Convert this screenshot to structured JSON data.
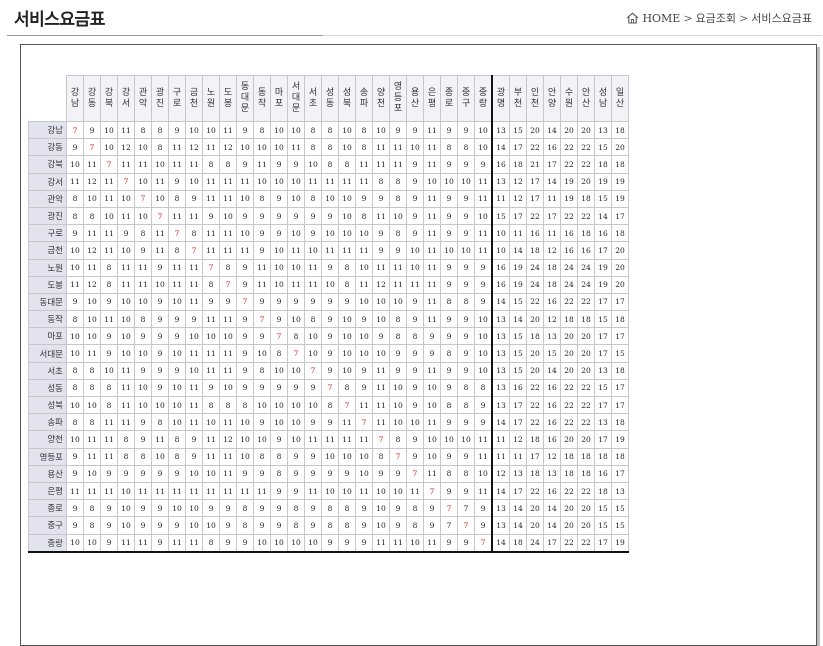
{
  "page": {
    "title": "서비스요금표",
    "breadcrumb": [
      "HOME",
      "요금조회",
      "서비스요금표"
    ],
    "breadcrumb_sep": ">"
  },
  "table": {
    "local_cols": [
      "강남",
      "강동",
      "강북",
      "강서",
      "관악",
      "광진",
      "구로",
      "금천",
      "노원",
      "도봉",
      "동대문",
      "동작",
      "마포",
      "서대문",
      "서초",
      "성동",
      "성북",
      "송파",
      "양천",
      "영등포",
      "용산",
      "은평",
      "종로",
      "중구",
      "중랑"
    ],
    "far_cols": [
      "광명",
      "부천",
      "인천",
      "안양",
      "수원",
      "안산",
      "성남",
      "일산"
    ],
    "rows": [
      {
        "name": "강남",
        "cells": [
          "7",
          "9",
          "10",
          "11",
          "8",
          "8",
          "9",
          "10",
          "10",
          "11",
          "9",
          "8",
          "10",
          "10",
          "8",
          "8",
          "10",
          "8",
          "10",
          "9",
          "9",
          "11",
          "9",
          "9",
          "10",
          "13",
          "15",
          "20",
          "14",
          "20",
          "20",
          "13",
          "18"
        ]
      },
      {
        "name": "강동",
        "cells": [
          "9",
          "7",
          "10",
          "12",
          "10",
          "8",
          "11",
          "12",
          "11",
          "12",
          "10",
          "10",
          "10",
          "11",
          "8",
          "8",
          "10",
          "8",
          "11",
          "11",
          "10",
          "11",
          "8",
          "8",
          "10",
          "14",
          "17",
          "22",
          "16",
          "22",
          "22",
          "15",
          "20"
        ]
      },
      {
        "name": "강북",
        "cells": [
          "10",
          "11",
          "7",
          "11",
          "11",
          "10",
          "11",
          "11",
          "8",
          "8",
          "9",
          "11",
          "9",
          "9",
          "10",
          "8",
          "8",
          "11",
          "11",
          "11",
          "9",
          "11",
          "9",
          "9",
          "9",
          "16",
          "18",
          "21",
          "17",
          "22",
          "22",
          "18",
          "18"
        ]
      },
      {
        "name": "강서",
        "cells": [
          "11",
          "12",
          "11",
          "7",
          "10",
          "11",
          "9",
          "10",
          "11",
          "11",
          "11",
          "10",
          "10",
          "10",
          "11",
          "11",
          "11",
          "11",
          "8",
          "8",
          "9",
          "10",
          "10",
          "10",
          "11",
          "13",
          "12",
          "17",
          "14",
          "19",
          "20",
          "19",
          "19"
        ]
      },
      {
        "name": "관악",
        "cells": [
          "8",
          "10",
          "11",
          "10",
          "7",
          "10",
          "8",
          "9",
          "11",
          "11",
          "10",
          "8",
          "9",
          "10",
          "8",
          "10",
          "10",
          "9",
          "9",
          "8",
          "9",
          "11",
          "9",
          "9",
          "11",
          "11",
          "12",
          "17",
          "11",
          "19",
          "18",
          "15",
          "19"
        ]
      },
      {
        "name": "광진",
        "cells": [
          "8",
          "8",
          "10",
          "11",
          "10",
          "7",
          "11",
          "11",
          "9",
          "10",
          "9",
          "9",
          "9",
          "9",
          "9",
          "9",
          "10",
          "8",
          "11",
          "10",
          "9",
          "11",
          "9",
          "9",
          "10",
          "15",
          "17",
          "22",
          "17",
          "22",
          "22",
          "14",
          "17"
        ]
      },
      {
        "name": "구로",
        "cells": [
          "9",
          "11",
          "11",
          "9",
          "8",
          "11",
          "7",
          "8",
          "11",
          "11",
          "10",
          "9",
          "9",
          "10",
          "9",
          "10",
          "10",
          "10",
          "9",
          "8",
          "9",
          "11",
          "9",
          "9",
          "11",
          "10",
          "11",
          "16",
          "11",
          "16",
          "18",
          "16",
          "18"
        ]
      },
      {
        "name": "금천",
        "cells": [
          "10",
          "12",
          "11",
          "10",
          "9",
          "11",
          "8",
          "7",
          "11",
          "11",
          "11",
          "9",
          "10",
          "11",
          "10",
          "11",
          "11",
          "11",
          "9",
          "9",
          "10",
          "11",
          "10",
          "10",
          "11",
          "10",
          "14",
          "18",
          "12",
          "16",
          "16",
          "17",
          "20"
        ]
      },
      {
        "name": "노원",
        "cells": [
          "10",
          "11",
          "8",
          "11",
          "11",
          "9",
          "11",
          "11",
          "7",
          "8",
          "9",
          "11",
          "10",
          "10",
          "11",
          "9",
          "8",
          "10",
          "11",
          "11",
          "10",
          "11",
          "9",
          "9",
          "9",
          "16",
          "19",
          "24",
          "18",
          "24",
          "24",
          "19",
          "20"
        ]
      },
      {
        "name": "도봉",
        "cells": [
          "11",
          "12",
          "8",
          "11",
          "11",
          "10",
          "11",
          "11",
          "8",
          "7",
          "9",
          "11",
          "10",
          "11",
          "11",
          "10",
          "8",
          "11",
          "12",
          "11",
          "11",
          "11",
          "9",
          "9",
          "9",
          "16",
          "19",
          "24",
          "18",
          "24",
          "24",
          "19",
          "20"
        ]
      },
      {
        "name": "동대문",
        "cells": [
          "9",
          "10",
          "9",
          "10",
          "10",
          "9",
          "10",
          "11",
          "9",
          "9",
          "7",
          "9",
          "9",
          "9",
          "9",
          "9",
          "9",
          "10",
          "10",
          "10",
          "9",
          "11",
          "8",
          "8",
          "9",
          "14",
          "15",
          "22",
          "16",
          "22",
          "22",
          "17",
          "17"
        ]
      },
      {
        "name": "동작",
        "cells": [
          "8",
          "10",
          "11",
          "10",
          "8",
          "9",
          "9",
          "9",
          "11",
          "11",
          "9",
          "7",
          "9",
          "10",
          "8",
          "9",
          "10",
          "9",
          "10",
          "8",
          "9",
          "11",
          "9",
          "9",
          "10",
          "13",
          "14",
          "20",
          "12",
          "18",
          "18",
          "15",
          "18"
        ]
      },
      {
        "name": "마포",
        "cells": [
          "10",
          "10",
          "9",
          "10",
          "9",
          "9",
          "9",
          "10",
          "10",
          "10",
          "9",
          "9",
          "7",
          "8",
          "10",
          "9",
          "10",
          "10",
          "9",
          "8",
          "8",
          "9",
          "9",
          "9",
          "10",
          "13",
          "15",
          "18",
          "13",
          "20",
          "20",
          "17",
          "17"
        ]
      },
      {
        "name": "서대문",
        "cells": [
          "10",
          "11",
          "9",
          "10",
          "10",
          "9",
          "10",
          "11",
          "11",
          "11",
          "9",
          "10",
          "8",
          "7",
          "10",
          "9",
          "10",
          "10",
          "10",
          "9",
          "9",
          "9",
          "8",
          "9",
          "10",
          "13",
          "15",
          "20",
          "15",
          "20",
          "20",
          "17",
          "15"
        ]
      },
      {
        "name": "서초",
        "cells": [
          "8",
          "8",
          "10",
          "11",
          "9",
          "9",
          "9",
          "10",
          "11",
          "11",
          "9",
          "8",
          "10",
          "10",
          "7",
          "9",
          "10",
          "9",
          "11",
          "9",
          "9",
          "11",
          "9",
          "9",
          "10",
          "13",
          "15",
          "20",
          "14",
          "20",
          "20",
          "13",
          "18"
        ]
      },
      {
        "name": "성동",
        "cells": [
          "8",
          "8",
          "8",
          "11",
          "10",
          "9",
          "10",
          "11",
          "9",
          "10",
          "9",
          "9",
          "9",
          "9",
          "9",
          "7",
          "8",
          "9",
          "11",
          "10",
          "9",
          "10",
          "9",
          "8",
          "8",
          "13",
          "16",
          "22",
          "16",
          "22",
          "22",
          "15",
          "17"
        ]
      },
      {
        "name": "성북",
        "cells": [
          "10",
          "10",
          "8",
          "11",
          "10",
          "10",
          "10",
          "11",
          "8",
          "8",
          "8",
          "10",
          "10",
          "10",
          "10",
          "8",
          "7",
          "11",
          "11",
          "10",
          "9",
          "10",
          "8",
          "8",
          "9",
          "13",
          "17",
          "22",
          "16",
          "22",
          "22",
          "17",
          "17"
        ]
      },
      {
        "name": "송파",
        "cells": [
          "8",
          "8",
          "11",
          "11",
          "9",
          "8",
          "10",
          "11",
          "10",
          "11",
          "10",
          "9",
          "10",
          "10",
          "9",
          "9",
          "11",
          "7",
          "11",
          "10",
          "10",
          "11",
          "9",
          "9",
          "9",
          "14",
          "17",
          "22",
          "16",
          "22",
          "22",
          "13",
          "18"
        ]
      },
      {
        "name": "양천",
        "cells": [
          "10",
          "11",
          "11",
          "8",
          "9",
          "11",
          "8",
          "9",
          "11",
          "12",
          "10",
          "10",
          "9",
          "10",
          "11",
          "11",
          "11",
          "11",
          "7",
          "8",
          "9",
          "10",
          "10",
          "10",
          "11",
          "11",
          "12",
          "18",
          "16",
          "20",
          "20",
          "17",
          "19"
        ]
      },
      {
        "name": "영등포",
        "cells": [
          "9",
          "11",
          "11",
          "8",
          "8",
          "10",
          "8",
          "9",
          "11",
          "11",
          "10",
          "8",
          "8",
          "9",
          "9",
          "10",
          "10",
          "10",
          "8",
          "7",
          "9",
          "10",
          "9",
          "9",
          "11",
          "11",
          "11",
          "17",
          "12",
          "18",
          "18",
          "18",
          "18"
        ]
      },
      {
        "name": "용산",
        "cells": [
          "9",
          "10",
          "9",
          "9",
          "9",
          "9",
          "9",
          "10",
          "10",
          "11",
          "9",
          "9",
          "8",
          "9",
          "9",
          "9",
          "9",
          "10",
          "9",
          "9",
          "7",
          "11",
          "8",
          "8",
          "10",
          "12",
          "13",
          "18",
          "13",
          "18",
          "18",
          "16",
          "17"
        ]
      },
      {
        "name": "은평",
        "cells": [
          "11",
          "11",
          "11",
          "10",
          "11",
          "11",
          "11",
          "11",
          "11",
          "11",
          "11",
          "11",
          "9",
          "9",
          "11",
          "10",
          "10",
          "11",
          "10",
          "10",
          "11",
          "7",
          "9",
          "9",
          "11",
          "14",
          "17",
          "22",
          "16",
          "22",
          "22",
          "18",
          "13"
        ]
      },
      {
        "name": "종로",
        "cells": [
          "9",
          "8",
          "9",
          "10",
          "9",
          "9",
          "10",
          "10",
          "9",
          "9",
          "8",
          "9",
          "9",
          "8",
          "9",
          "8",
          "8",
          "9",
          "10",
          "9",
          "8",
          "9",
          "7",
          "7",
          "9",
          "13",
          "14",
          "20",
          "14",
          "20",
          "20",
          "15",
          "15"
        ]
      },
      {
        "name": "중구",
        "cells": [
          "9",
          "8",
          "9",
          "10",
          "9",
          "9",
          "9",
          "10",
          "10",
          "9",
          "8",
          "9",
          "9",
          "8",
          "9",
          "8",
          "8",
          "9",
          "10",
          "9",
          "8",
          "9",
          "7",
          "7",
          "9",
          "13",
          "14",
          "20",
          "14",
          "20",
          "20",
          "15",
          "15"
        ]
      },
      {
        "name": "중랑",
        "cells": [
          "10",
          "10",
          "9",
          "11",
          "11",
          "9",
          "11",
          "11",
          "8",
          "9",
          "9",
          "10",
          "10",
          "10",
          "10",
          "9",
          "9",
          "9",
          "11",
          "11",
          "10",
          "11",
          "9",
          "9",
          "7",
          "14",
          "18",
          "24",
          "17",
          "22",
          "22",
          "17",
          "19"
        ]
      }
    ]
  }
}
